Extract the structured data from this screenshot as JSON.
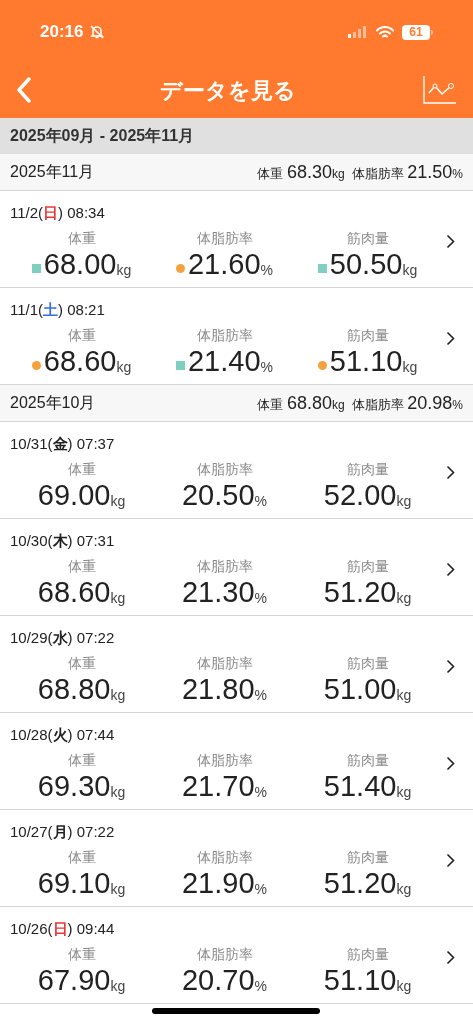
{
  "status_bar": {
    "time": "20:16",
    "battery": "61"
  },
  "nav": {
    "title": "データを見る"
  },
  "range": "2025年09月 - 2025年11月",
  "groups": [
    {
      "month": "2025年11月",
      "summary": [
        {
          "label": "体重",
          "value": "68.30",
          "unit": "kg"
        },
        {
          "label": "体脂肪率",
          "value": "21.50",
          "unit": "%"
        }
      ],
      "rows": [
        {
          "date": "11/2(",
          "weekday": {
            "text": "日",
            "color": "#e53935"
          },
          "time": ") 08:34",
          "metrics": [
            {
              "label": "体重",
              "value": "68.00",
              "unit": "kg",
              "kind": "square",
              "color": "#7fcfc0"
            },
            {
              "label": "体脂肪率",
              "value": "21.60",
              "unit": "%",
              "kind": "dot",
              "color": "#f4a140"
            },
            {
              "label": "筋肉量",
              "value": "50.50",
              "unit": "kg",
              "kind": "square",
              "color": "#7fcfc0"
            }
          ]
        },
        {
          "date": "11/1(",
          "weekday": {
            "text": "土",
            "color": "#3a6fd8"
          },
          "time": ") 08:21",
          "metrics": [
            {
              "label": "体重",
              "value": "68.60",
              "unit": "kg",
              "kind": "dot",
              "color": "#f4a140"
            },
            {
              "label": "体脂肪率",
              "value": "21.40",
              "unit": "%",
              "kind": "square",
              "color": "#7fcfc0"
            },
            {
              "label": "筋肉量",
              "value": "51.10",
              "unit": "kg",
              "kind": "dot",
              "color": "#f4a140"
            }
          ]
        }
      ]
    },
    {
      "month": "2025年10月",
      "summary": [
        {
          "label": "体重",
          "value": "68.80",
          "unit": "kg"
        },
        {
          "label": "体脂肪率",
          "value": "20.98",
          "unit": "%"
        }
      ],
      "rows": [
        {
          "date": "10/31(",
          "weekday": {
            "text": "金",
            "color": "#222222"
          },
          "time": ") 07:37",
          "metrics": [
            {
              "label": "体重",
              "value": "69.00",
              "unit": "kg"
            },
            {
              "label": "体脂肪率",
              "value": "20.50",
              "unit": "%"
            },
            {
              "label": "筋肉量",
              "value": "52.00",
              "unit": "kg"
            }
          ]
        },
        {
          "date": "10/30(",
          "weekday": {
            "text": "木",
            "color": "#222222"
          },
          "time": ") 07:31",
          "metrics": [
            {
              "label": "体重",
              "value": "68.60",
              "unit": "kg"
            },
            {
              "label": "体脂肪率",
              "value": "21.30",
              "unit": "%"
            },
            {
              "label": "筋肉量",
              "value": "51.20",
              "unit": "kg"
            }
          ]
        },
        {
          "date": "10/29(",
          "weekday": {
            "text": "水",
            "color": "#222222"
          },
          "time": ") 07:22",
          "metrics": [
            {
              "label": "体重",
              "value": "68.80",
              "unit": "kg"
            },
            {
              "label": "体脂肪率",
              "value": "21.80",
              "unit": "%"
            },
            {
              "label": "筋肉量",
              "value": "51.00",
              "unit": "kg"
            }
          ]
        },
        {
          "date": "10/28(",
          "weekday": {
            "text": "火",
            "color": "#222222"
          },
          "time": ") 07:44",
          "metrics": [
            {
              "label": "体重",
              "value": "69.30",
              "unit": "kg"
            },
            {
              "label": "体脂肪率",
              "value": "21.70",
              "unit": "%"
            },
            {
              "label": "筋肉量",
              "value": "51.40",
              "unit": "kg"
            }
          ]
        },
        {
          "date": "10/27(",
          "weekday": {
            "text": "月",
            "color": "#222222"
          },
          "time": ") 07:22",
          "metrics": [
            {
              "label": "体重",
              "value": "69.10",
              "unit": "kg"
            },
            {
              "label": "体脂肪率",
              "value": "21.90",
              "unit": "%"
            },
            {
              "label": "筋肉量",
              "value": "51.20",
              "unit": "kg"
            }
          ]
        },
        {
          "date": "10/26(",
          "weekday": {
            "text": "日",
            "color": "#e53935"
          },
          "time": ") 09:44",
          "metrics": [
            {
              "label": "体重",
              "value": "67.90",
              "unit": "kg"
            },
            {
              "label": "体脂肪率",
              "value": "20.70",
              "unit": "%"
            },
            {
              "label": "筋肉量",
              "value": "51.10",
              "unit": "kg"
            }
          ]
        }
      ]
    }
  ]
}
